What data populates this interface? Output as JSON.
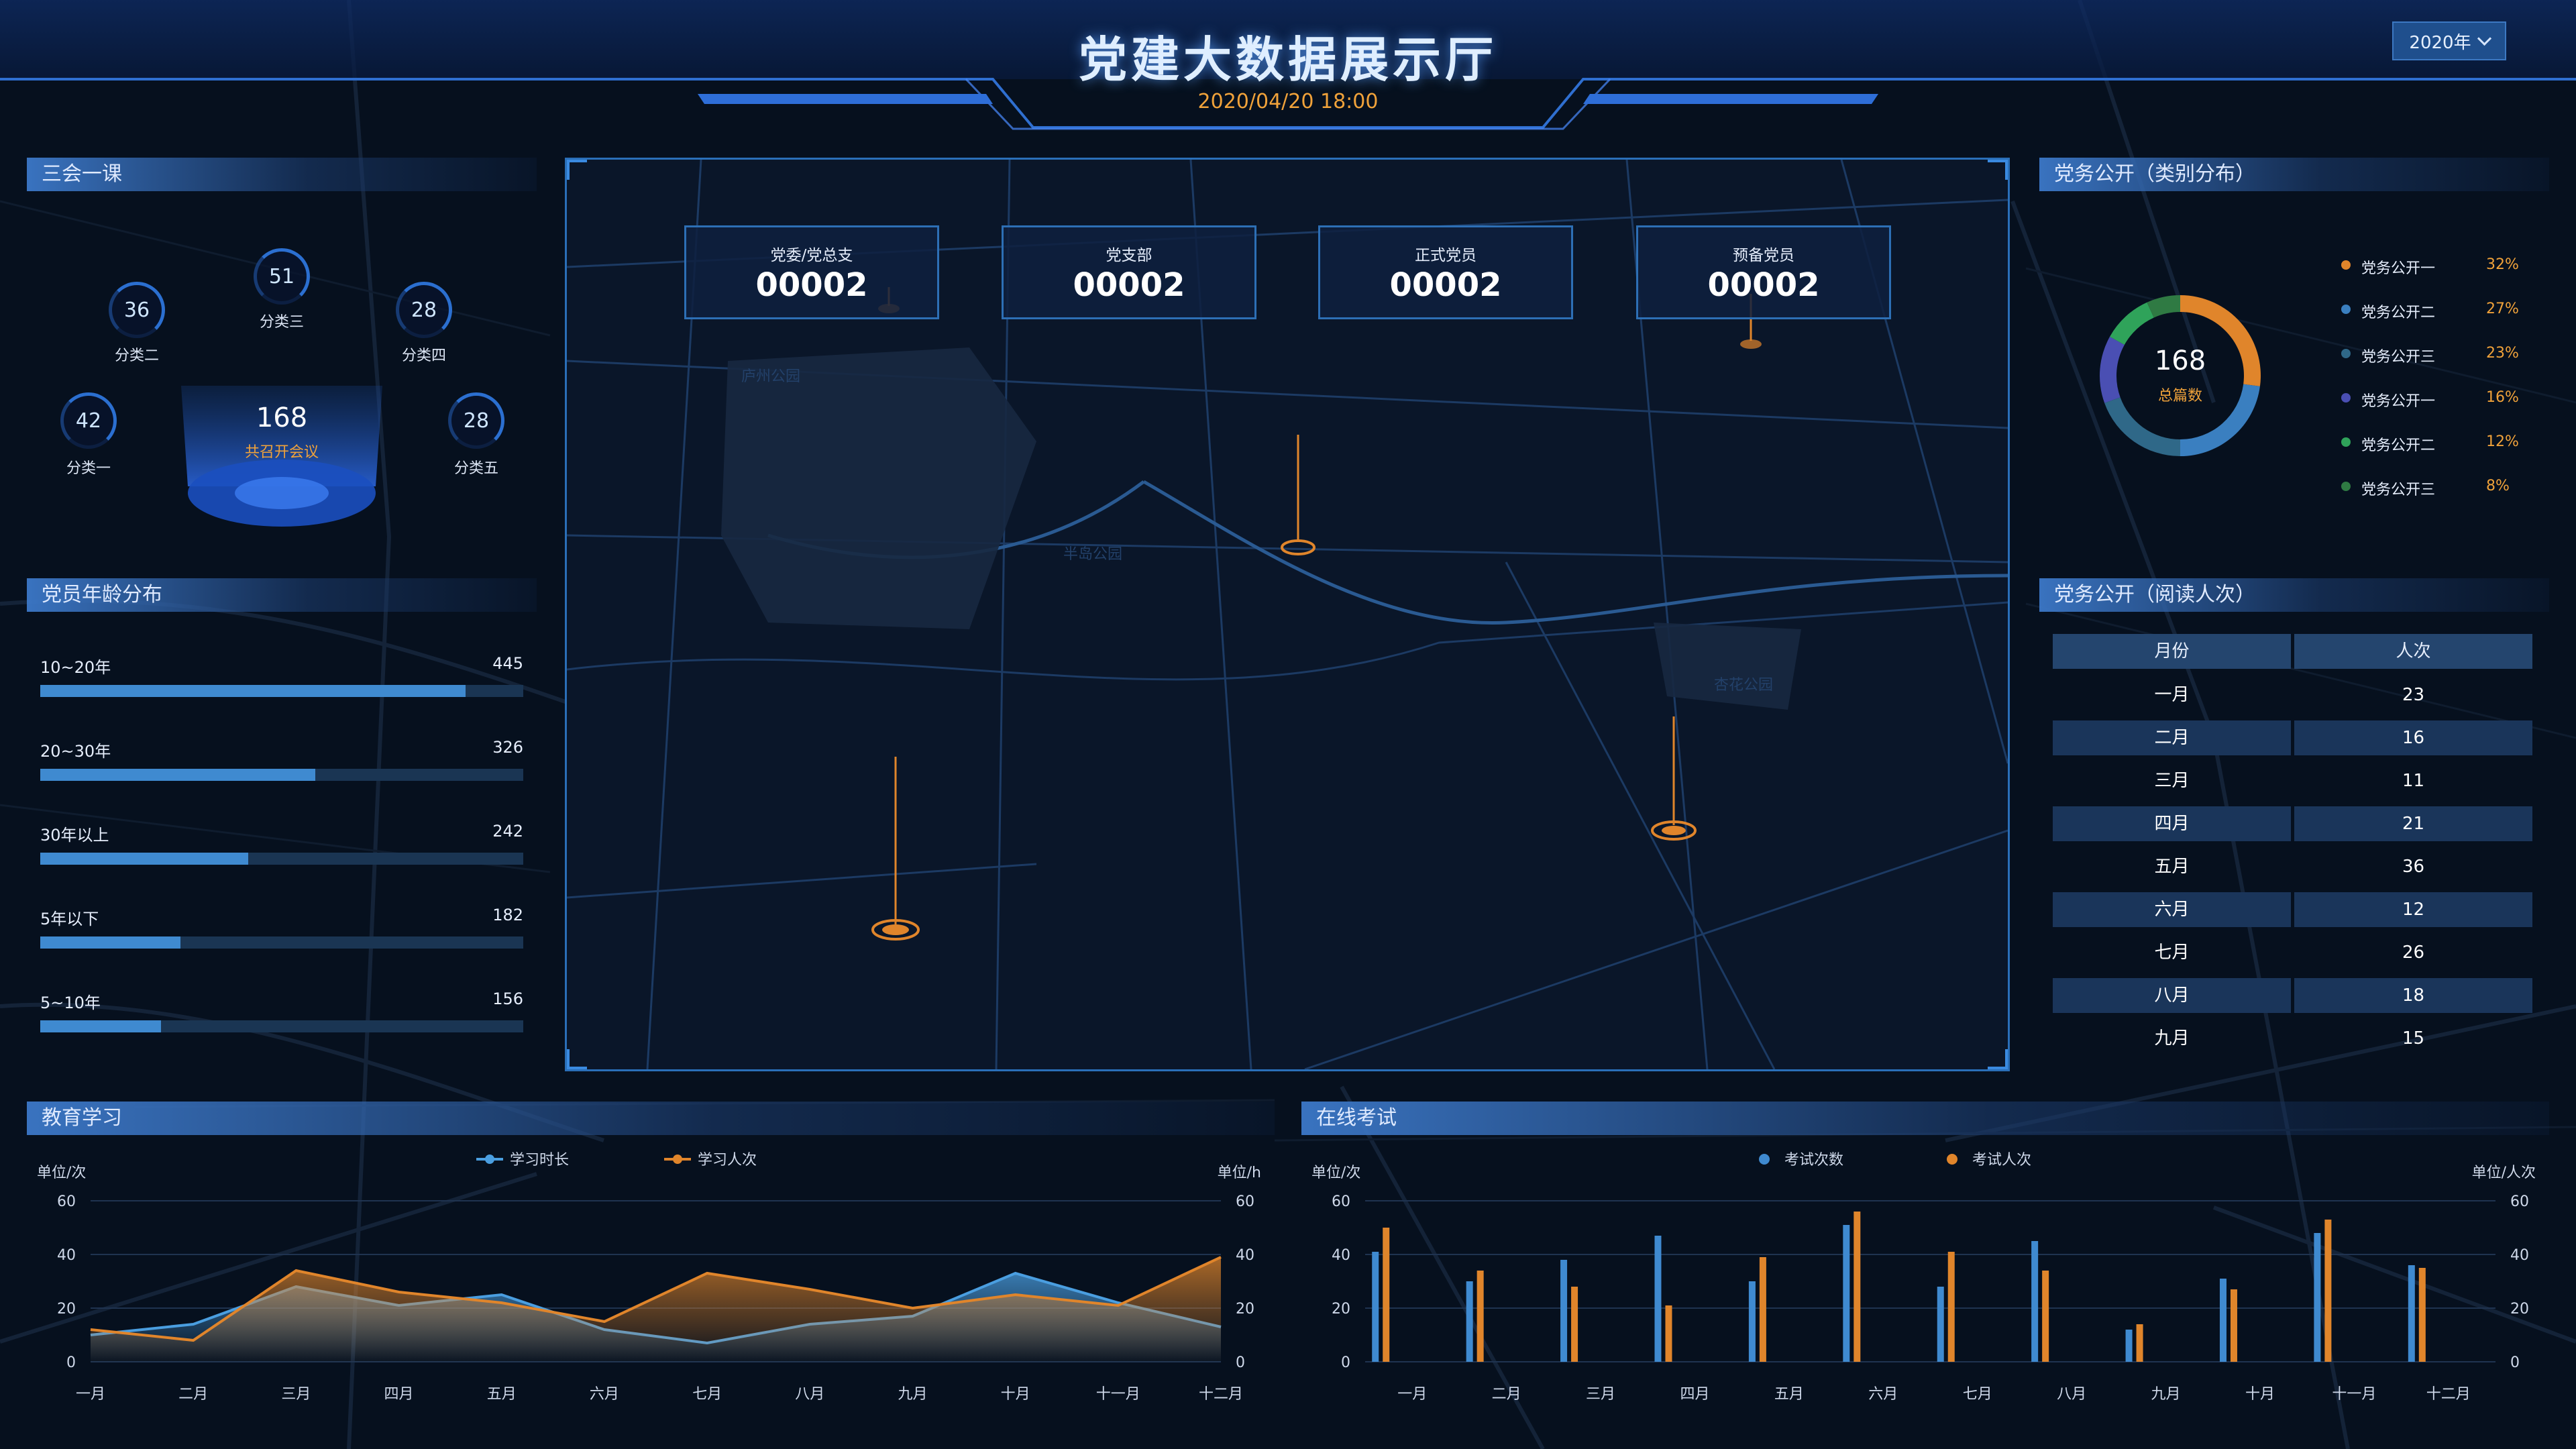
{
  "header": {
    "title": "党建大数据展示厅",
    "datetime": "2020/04/20  18:00",
    "year": "2020年"
  },
  "meetings": {
    "title": "三会一课",
    "total": "168",
    "total_label": "共召开会议",
    "items": [
      {
        "label": "分类一",
        "value": "42"
      },
      {
        "label": "分类二",
        "value": "36"
      },
      {
        "label": "分类三",
        "value": "51"
      },
      {
        "label": "分类四",
        "value": "28"
      },
      {
        "label": "分类五",
        "value": "28"
      }
    ]
  },
  "age": {
    "title": "党员年龄分布",
    "max": 445,
    "rows": [
      {
        "label": "10~20年",
        "value": 445,
        "fill": 0.88
      },
      {
        "label": "20~30年",
        "value": 326,
        "fill": 0.57
      },
      {
        "label": "30年以上",
        "value": 242,
        "fill": 0.43
      },
      {
        "label": "5年以下",
        "value": 182,
        "fill": 0.29
      },
      {
        "label": "5~10年",
        "value": 156,
        "fill": 0.25
      }
    ]
  },
  "map": {
    "stats": [
      {
        "label": "党委/党总支",
        "value": "00002"
      },
      {
        "label": "党支部",
        "value": "00002"
      },
      {
        "label": "正式党员",
        "value": "00002"
      },
      {
        "label": "预备党员",
        "value": "00002"
      }
    ],
    "place_labels": [
      "庐州公园",
      "半岛公园",
      "杏花公园"
    ]
  },
  "publish_category": {
    "title": "党务公开（类别分布）",
    "total": "168",
    "total_label": "总篇数",
    "items": [
      {
        "name": "党务公开一",
        "pct": "32%",
        "value": 32,
        "color": "#e0852b"
      },
      {
        "name": "党务公开二",
        "pct": "27%",
        "value": 27,
        "color": "#3a7fc0"
      },
      {
        "name": "党务公开三",
        "pct": "23%",
        "value": 23,
        "color": "#2f6888"
      },
      {
        "name": "党务公开一",
        "pct": "16%",
        "value": 16,
        "color": "#4a4fb3"
      },
      {
        "name": "党务公开二",
        "pct": "12%",
        "value": 12,
        "color": "#2fa35a"
      },
      {
        "name": "党务公开三",
        "pct": "8%",
        "value": 8,
        "color": "#2f7a43"
      }
    ]
  },
  "publish_reads": {
    "title": "党务公开（阅读人次）",
    "headers": [
      "月份",
      "人次"
    ],
    "rows": [
      [
        "一月",
        "23"
      ],
      [
        "二月",
        "16"
      ],
      [
        "三月",
        "11"
      ],
      [
        "四月",
        "21"
      ],
      [
        "五月",
        "36"
      ],
      [
        "六月",
        "12"
      ],
      [
        "七月",
        "26"
      ],
      [
        "八月",
        "18"
      ],
      [
        "九月",
        "15"
      ]
    ]
  },
  "colors": {
    "accent_blue": "#3f8ad0",
    "accent_orange": "#e0852b"
  },
  "chart_data": [
    {
      "type": "area",
      "title": "教育学习",
      "left_unit": "单位/次",
      "right_unit": "单位/h",
      "categories": [
        "一月",
        "二月",
        "三月",
        "四月",
        "五月",
        "六月",
        "七月",
        "八月",
        "九月",
        "十月",
        "十一月",
        "十二月"
      ],
      "ylim": [
        0,
        60
      ],
      "yticks": [
        "0",
        "20",
        "40",
        "60"
      ],
      "series": [
        {
          "name": "学习时长",
          "color": "#4a9ee0",
          "values": [
            10,
            14,
            28,
            21,
            25,
            12,
            7,
            14,
            17,
            33,
            22,
            13
          ]
        },
        {
          "name": "学习人次",
          "color": "#e0852b",
          "values": [
            12,
            8,
            34,
            26,
            22,
            15,
            33,
            27,
            20,
            25,
            21,
            39
          ]
        }
      ],
      "legend": "top-center"
    },
    {
      "type": "bar",
      "title": "在线考试",
      "left_unit": "单位/次",
      "right_unit": "单位/人次",
      "categories": [
        "一月",
        "二月",
        "三月",
        "四月",
        "五月",
        "六月",
        "七月",
        "八月",
        "九月",
        "十月",
        "十一月",
        "十二月"
      ],
      "ylim": [
        0,
        60
      ],
      "yticks": [
        "0",
        "20",
        "40",
        "60"
      ],
      "series": [
        {
          "name": "考试次数",
          "color": "#3f8ad0",
          "values": [
            41,
            30,
            38,
            47,
            30,
            51,
            28,
            45,
            12,
            31,
            48,
            36
          ]
        },
        {
          "name": "考试人次",
          "color": "#e0852b",
          "values": [
            50,
            34,
            28,
            21,
            39,
            56,
            41,
            34,
            14,
            27,
            53,
            35
          ]
        }
      ],
      "legend": "top-center"
    }
  ]
}
